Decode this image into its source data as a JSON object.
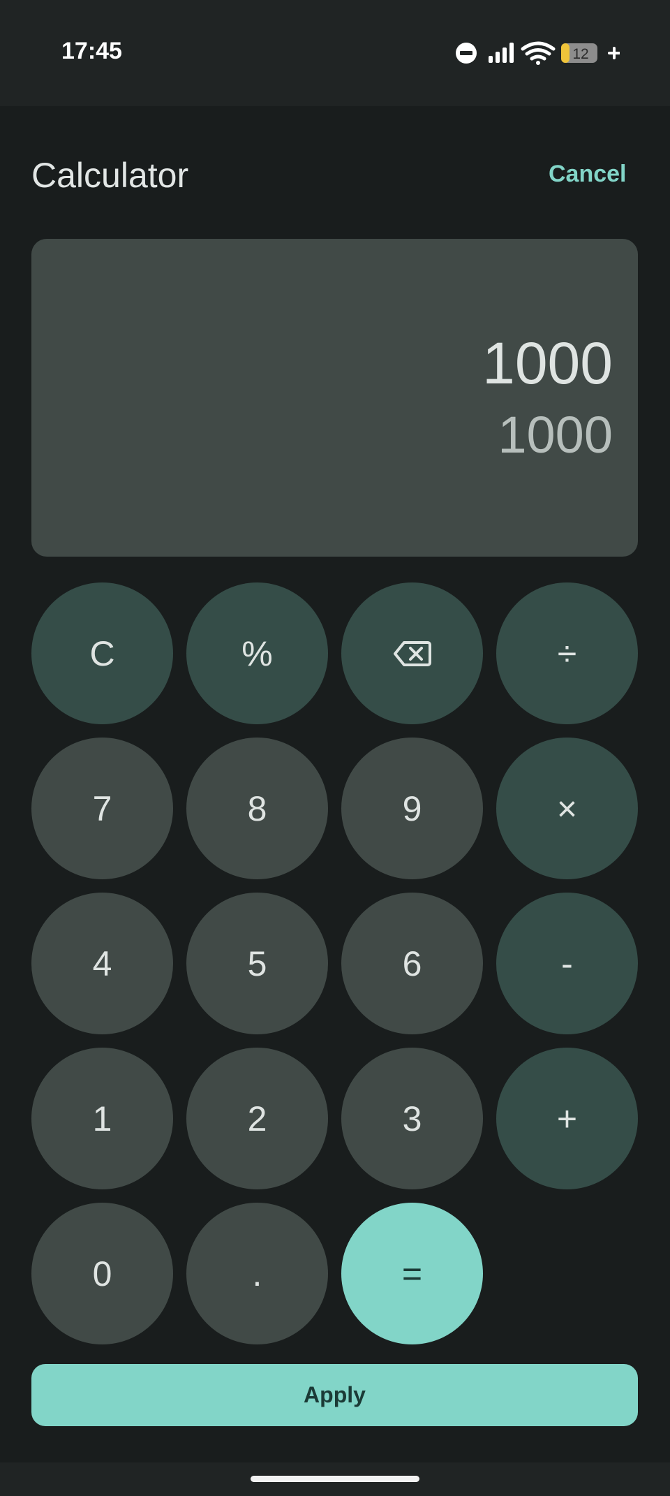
{
  "status_bar": {
    "time": "17:45",
    "battery_level": "12",
    "icons": [
      "do-not-disturb-icon",
      "signal-icon",
      "wifi-icon",
      "battery-icon",
      "charging-plus-icon"
    ]
  },
  "header": {
    "title": "Calculator",
    "cancel_label": "Cancel"
  },
  "display": {
    "expression": "1000",
    "result": "1000"
  },
  "keypad": {
    "clear": "C",
    "percent": "%",
    "backspace_icon": "backspace-icon",
    "divide": "÷",
    "seven": "7",
    "eight": "8",
    "nine": "9",
    "multiply": "×",
    "four": "4",
    "five": "5",
    "six": "6",
    "minus": "-",
    "one": "1",
    "two": "2",
    "three": "3",
    "plus": "+",
    "zero": "0",
    "decimal": ".",
    "equals": "="
  },
  "footer": {
    "apply_label": "Apply"
  },
  "colors": {
    "background": "#191d1d",
    "accent": "#82d5c8",
    "display_bg": "#414a47",
    "number_key": "#414a47",
    "operator_key": "#354d48"
  }
}
